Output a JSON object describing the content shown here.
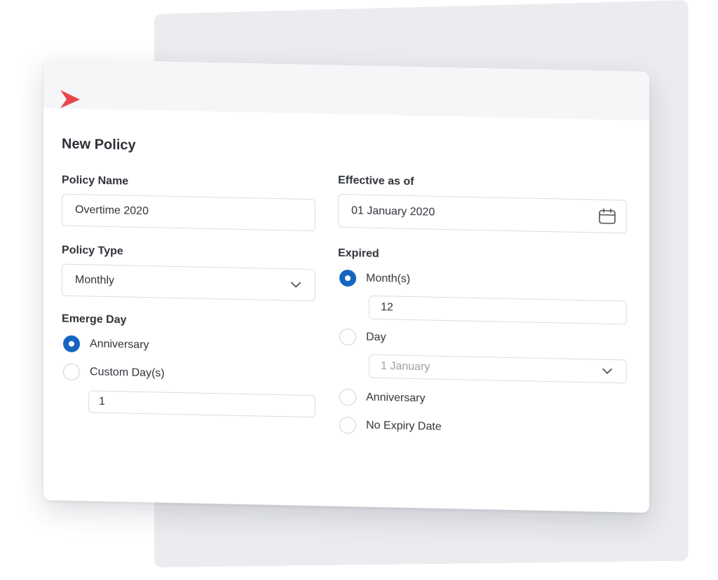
{
  "form": {
    "title": "New Policy",
    "policy_name": {
      "label": "Policy Name",
      "value": "Overtime 2020"
    },
    "effective": {
      "label": "Effective as of",
      "value": "01 January 2020"
    },
    "policy_type": {
      "label": "Policy Type",
      "value": "Monthly"
    },
    "emerge_day": {
      "label": "Emerge Day",
      "options": [
        {
          "label": "Anniversary",
          "selected": true
        },
        {
          "label": "Custom Day(s)",
          "selected": false
        }
      ],
      "custom_days_value": "1"
    },
    "expired": {
      "label": "Expired",
      "options": [
        {
          "label": "Month(s)",
          "selected": true
        },
        {
          "label": "Day",
          "selected": false
        },
        {
          "label": "Anniversary",
          "selected": false
        },
        {
          "label": "No Expiry Date",
          "selected": false
        }
      ],
      "months_value": "12",
      "day_value": "1 January"
    }
  },
  "colors": {
    "accent": "#1565c0",
    "logo": "#e8474c"
  }
}
